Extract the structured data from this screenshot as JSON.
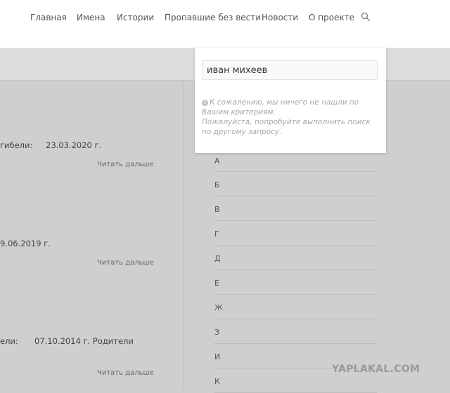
{
  "nav": {
    "items": [
      "Главная",
      "Имена",
      "Истории",
      "Пропавшие без вести",
      "Новости",
      "О проекте"
    ]
  },
  "search": {
    "value": "иван михеев",
    "message_line1": "К сожалению, мы ничего не нашли по Вашим критериям.",
    "message_line2": "Пожалуйста, попробуйте выполнить поиск по другому запросу.",
    "icon": "info-icon"
  },
  "entries": [
    {
      "text": "гибели:",
      "date": "23.03.2020 г.",
      "read_more": "Читать дальше"
    },
    {
      "text": "",
      "date": "9.06.2019 г.",
      "read_more": "Читать дальше"
    },
    {
      "text": "ели:",
      "date": "07.10.2014 г. Родители",
      "read_more": "Читать дальше"
    }
  ],
  "letters": [
    "А",
    "Б",
    "В",
    "Г",
    "Д",
    "Е",
    "Ж",
    "З",
    "И",
    "К"
  ],
  "watermark": "YAPLAKAL.COM"
}
